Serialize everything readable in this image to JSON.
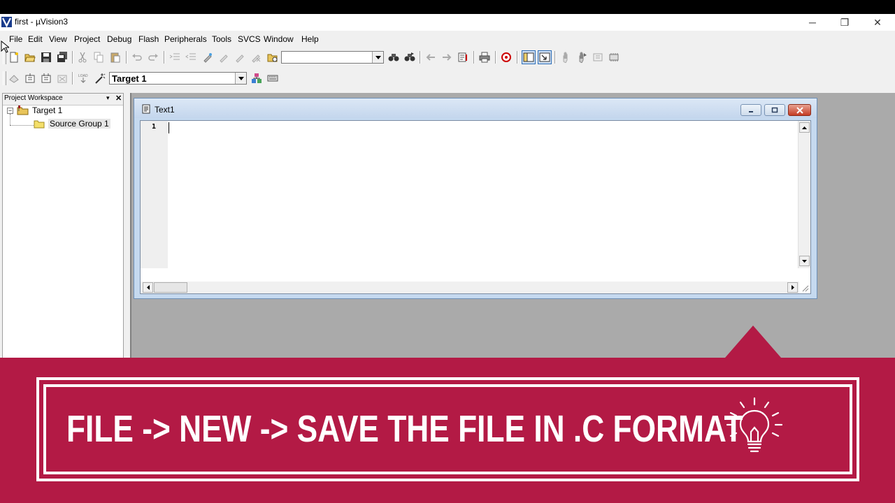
{
  "window": {
    "title": "first  - µVision3",
    "controls": {
      "minimize": "─",
      "restore": "❐",
      "close": "✕"
    }
  },
  "menu": [
    "File",
    "Edit",
    "View",
    "Project",
    "Debug",
    "Flash",
    "Peripherals",
    "Tools",
    "SVCS",
    "Window",
    "Help"
  ],
  "toolbar": {
    "find_combo_value": "",
    "target_combo_value": "Target 1"
  },
  "workspace": {
    "title": "Project Workspace",
    "tree": {
      "root": "Target 1",
      "child": "Source Group 1"
    }
  },
  "editor": {
    "title": "Text1",
    "line_numbers": [
      "1"
    ]
  },
  "banner": {
    "text": "FILE -> NEW -> SAVE THE FILE IN .C FORMAT",
    "icon": "lightbulb-icon",
    "color": "#b31a45"
  }
}
